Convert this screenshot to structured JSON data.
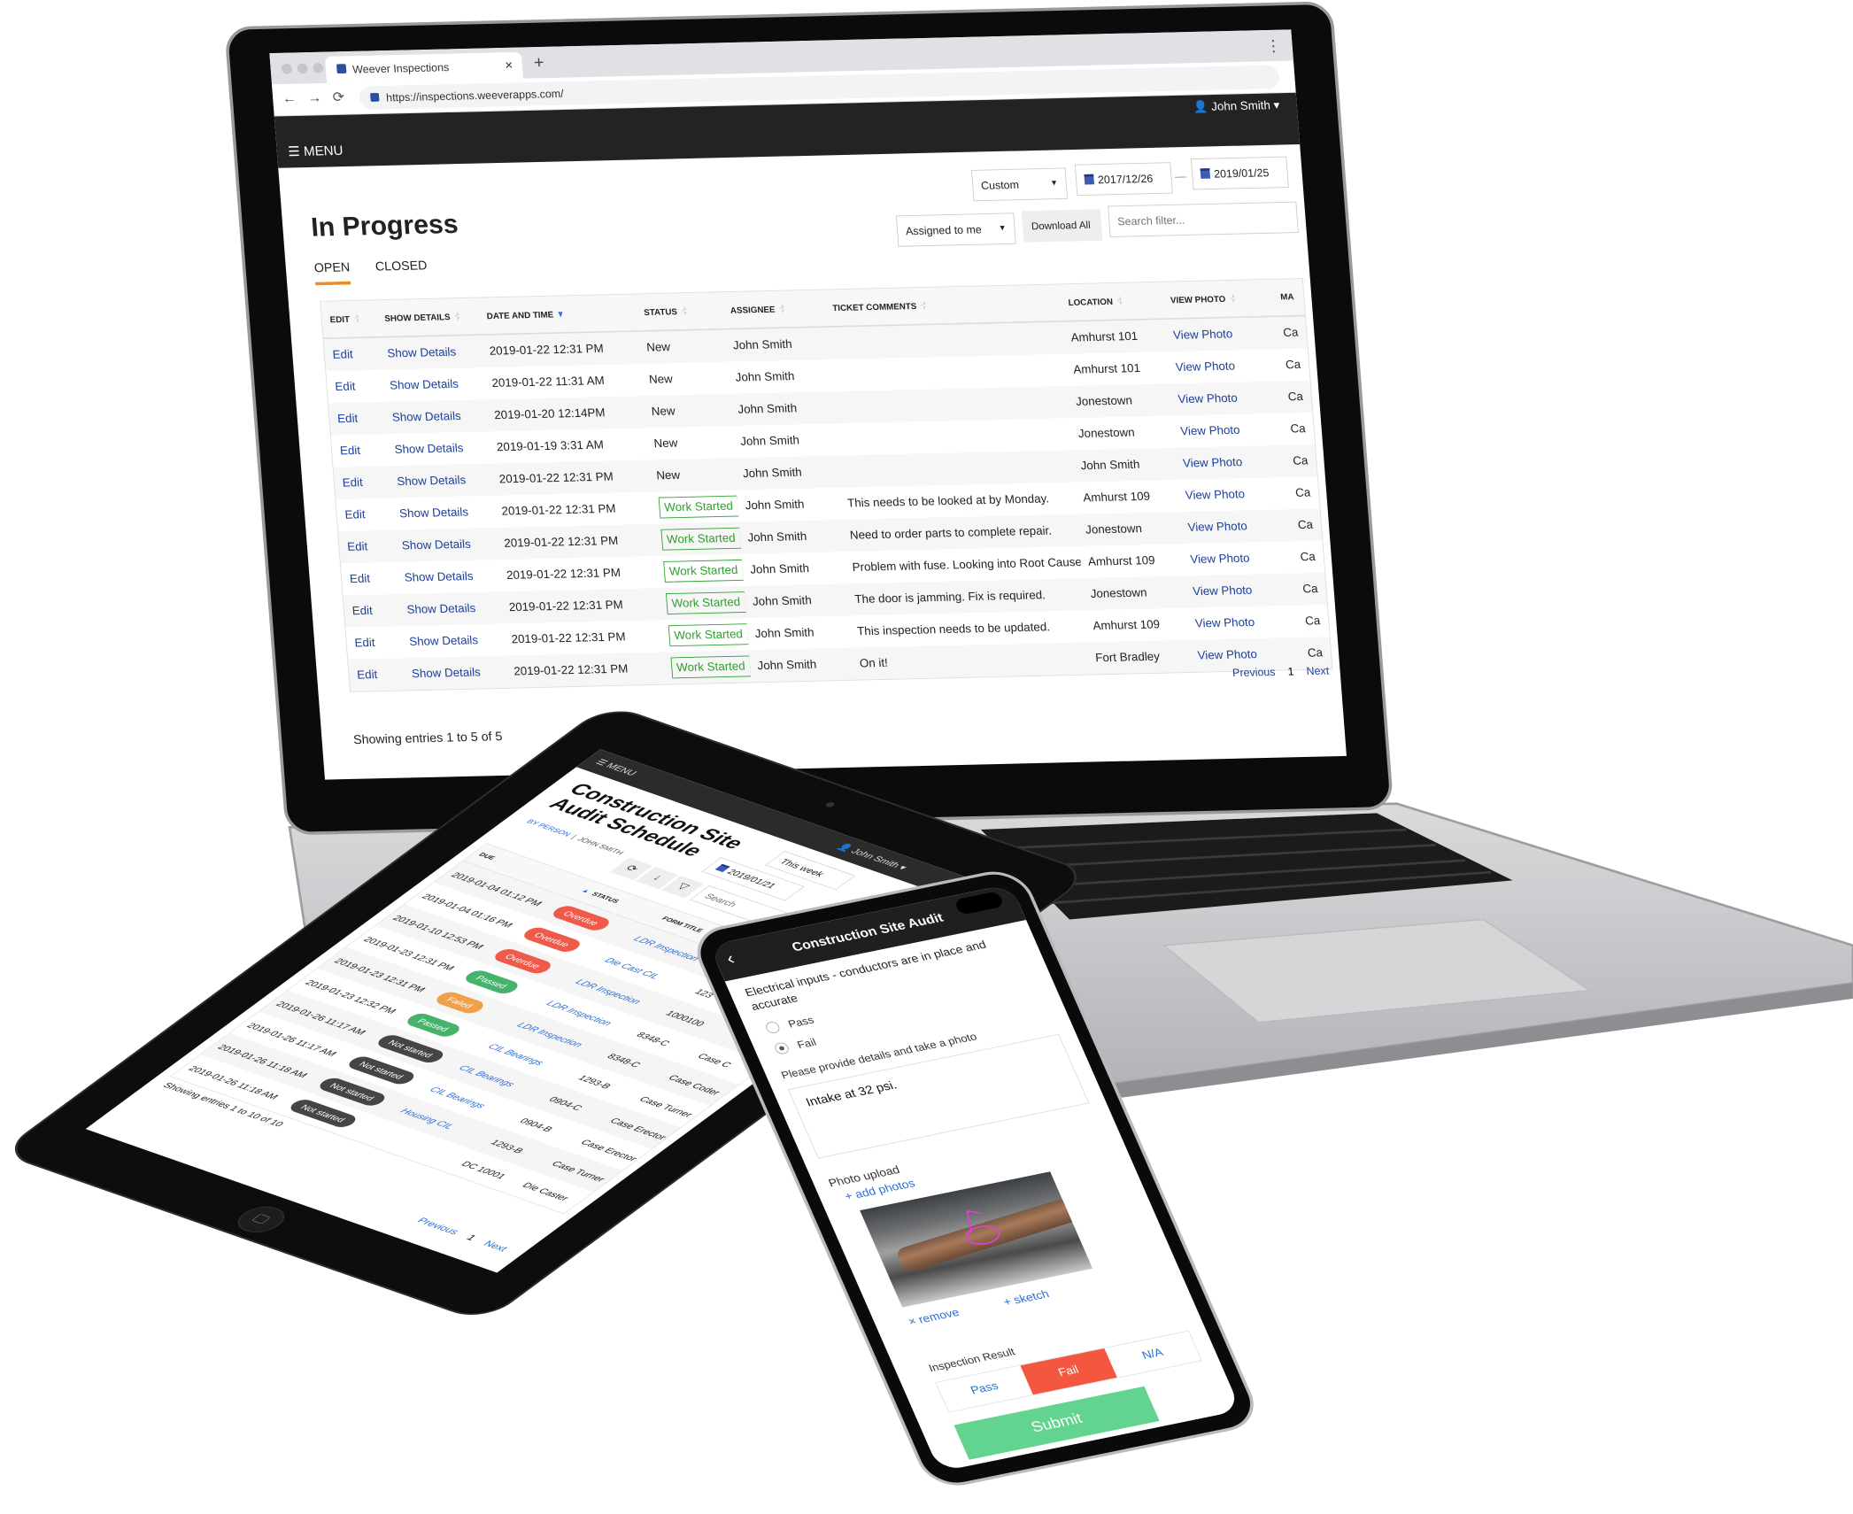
{
  "laptop": {
    "browser": {
      "tab_title": "Weever Inspections",
      "tab_close": "×",
      "new_tab": "+",
      "url": "https://inspections.weeverapps.com/",
      "menu_dots": "⋮",
      "back": "←",
      "forward": "→",
      "reload": "⟳"
    },
    "header": {
      "menu_label": "☰ MENU",
      "user": "👤 John Smith ▾"
    },
    "page_title": "In Progress",
    "filters": {
      "range": "Custom",
      "date_from": "2017/12/26",
      "date_sep": "—",
      "date_to": "2019/01/25",
      "assigned": "Assigned to me",
      "download": "Download All",
      "search_placeholder": "Search filter..."
    },
    "tabs": [
      {
        "label": "OPEN",
        "active": true
      },
      {
        "label": "CLOSED",
        "active": false
      }
    ],
    "table": {
      "columns": [
        "EDIT",
        "SHOW DETAILS",
        "DATE AND TIME",
        "STATUS",
        "ASSIGNEE",
        "TICKET COMMENTS",
        "LOCATION",
        "VIEW PHOTO",
        "MA"
      ],
      "rows": [
        {
          "edit": "Edit",
          "details": "Show Details",
          "date": "2019-01-22 12:31 PM",
          "status": "New",
          "assignee": "John Smith",
          "comment": "",
          "location": "Amhurst 101",
          "photo": "View Photo",
          "extra": "Ca"
        },
        {
          "edit": "Edit",
          "details": "Show Details",
          "date": "2019-01-22 11:31 AM",
          "status": "New",
          "assignee": "John Smith",
          "comment": "",
          "location": "Amhurst 101",
          "photo": "View Photo",
          "extra": "Ca"
        },
        {
          "edit": "Edit",
          "details": "Show Details",
          "date": "2019-01-20 12:14PM",
          "status": "New",
          "assignee": "John Smith",
          "comment": "",
          "location": "Jonestown",
          "photo": "View Photo",
          "extra": "Ca"
        },
        {
          "edit": "Edit",
          "details": "Show Details",
          "date": "2019-01-19 3:31 AM",
          "status": "New",
          "assignee": "John Smith",
          "comment": "",
          "location": "Jonestown",
          "photo": "View Photo",
          "extra": "Ca"
        },
        {
          "edit": "Edit",
          "details": "Show Details",
          "date": "2019-01-22 12:31 PM",
          "status": "New",
          "assignee": "John Smith",
          "comment": "",
          "location": "John Smith",
          "photo": "View Photo",
          "extra": "Ca"
        },
        {
          "edit": "Edit",
          "details": "Show Details",
          "date": "2019-01-22 12:31 PM",
          "status": "Work Started",
          "assignee": "John Smith",
          "comment": "This needs to be looked at by Monday.",
          "location": "Amhurst 109",
          "photo": "View Photo",
          "extra": "Ca"
        },
        {
          "edit": "Edit",
          "details": "Show Details",
          "date": "2019-01-22 12:31 PM",
          "status": "Work Started",
          "assignee": "John Smith",
          "comment": "Need to order parts to complete repair.",
          "location": "Jonestown",
          "photo": "View Photo",
          "extra": "Ca"
        },
        {
          "edit": "Edit",
          "details": "Show Details",
          "date": "2019-01-22 12:31 PM",
          "status": "Work Started",
          "assignee": "John Smith",
          "comment": "Problem with fuse. Looking into Root Cause.",
          "location": "Amhurst 109",
          "photo": "View Photo",
          "extra": "Ca"
        },
        {
          "edit": "Edit",
          "details": "Show Details",
          "date": "2019-01-22 12:31 PM",
          "status": "Work Started",
          "assignee": "John Smith",
          "comment": "The door is jamming. Fix is required.",
          "location": "Jonestown",
          "photo": "View Photo",
          "extra": "Ca"
        },
        {
          "edit": "Edit",
          "details": "Show Details",
          "date": "2019-01-22 12:31 PM",
          "status": "Work Started",
          "assignee": "John Smith",
          "comment": "This inspection needs to be updated.",
          "location": "Amhurst 109",
          "photo": "View Photo",
          "extra": "Ca"
        },
        {
          "edit": "Edit",
          "details": "Show Details",
          "date": "2019-01-22 12:31 PM",
          "status": "Work Started",
          "assignee": "John Smith",
          "comment": "On it!",
          "location": "Fort Bradley",
          "photo": "View Photo",
          "extra": "Ca"
        }
      ]
    },
    "footer": {
      "showing": "Showing entries 1 to 5 of 5",
      "previous": "Previous",
      "page": "1",
      "next": "Next"
    },
    "colors": {
      "accent": "#f08a24",
      "link": "#1b3f9c",
      "work_started": "#2f9f2f",
      "header_bg": "#232323"
    }
  },
  "tablet": {
    "menu_label": "☰ MENU",
    "user": "👤 John Smith ▾",
    "title": "Construction Site Audit Schedule",
    "breadcrumb": {
      "parent": "BY PERSON",
      "sep": "|",
      "current": "JOHN SMITH"
    },
    "filters": {
      "range": "This week",
      "date": "2019/01/21",
      "search_placeholder": "Search"
    },
    "icons": [
      "refresh-icon",
      "download-icon",
      "filter-icon"
    ],
    "table": {
      "columns": [
        "DUE",
        "STATUS",
        "FORM TITLE",
        "",
        ""
      ],
      "rows": [
        {
          "due": "2019-01-04 01:12 PM",
          "status": "Overdue",
          "form": "LDR Inspection",
          "code": "",
          "case": ""
        },
        {
          "due": "2019-01-04 01:16 PM",
          "status": "Overdue",
          "form": "Die Cast CIL",
          "code": "123",
          "case": ""
        },
        {
          "due": "2019-01-10 12:53 PM",
          "status": "Overdue",
          "form": "LDR Inspection",
          "code": "1000100",
          "case": ""
        },
        {
          "due": "2019-01-23 12:31 PM",
          "status": "Passed",
          "form": "LDR Inspection",
          "code": "8348-C",
          "case": "Case C"
        },
        {
          "due": "2019-01-23 12:31 PM",
          "status": "Failed",
          "form": "LDR Inspection",
          "code": "8348-C",
          "case": "Case Coder"
        },
        {
          "due": "2019-01-23 12:32 PM",
          "status": "Passed",
          "form": "CIL Bearings",
          "code": "1293-B",
          "case": "Case Turner"
        },
        {
          "due": "2019-01-26 11:17 AM",
          "status": "Not started",
          "form": "CIL Bearings",
          "code": "0904-C",
          "case": "Case Erector"
        },
        {
          "due": "2019-01-26 11:17 AM",
          "status": "Not started",
          "form": "CIL Bearings",
          "code": "0904-B",
          "case": "Case Erector"
        },
        {
          "due": "2019-01-26 11:18 AM",
          "status": "Not started",
          "form": "Housing CIL",
          "code": "1293-B",
          "case": "Case Turner"
        },
        {
          "due": "2019-01-26 11:18 AM",
          "status": "Not started",
          "form": "",
          "code": "DC 10001",
          "case": "Die Caster"
        }
      ]
    },
    "footer": {
      "showing": "Showing entries 1 to 10 of 10",
      "previous": "Previous",
      "page": "1",
      "next": "Next"
    },
    "status_colors": {
      "Overdue": "#f05a4a",
      "Passed": "#45b36b",
      "Failed": "#f0a04b",
      "Not started": "#454545"
    }
  },
  "phone": {
    "back": "‹",
    "title": "Construction Site Audit",
    "question": "Electrical inputs - conductors are in place and accurate",
    "options": [
      {
        "label": "Pass",
        "selected": false
      },
      {
        "label": "Fail",
        "selected": true
      }
    ],
    "details_label": "Please provide details and take a photo",
    "details_value": "Intake at 32 psi.",
    "photo_label": "Photo upload",
    "add_photos": "+ add photos",
    "remove": "× remove",
    "sketch": "+ sketch",
    "result_label": "Inspection Result",
    "result_options": [
      {
        "label": "Pass",
        "selected": false
      },
      {
        "label": "Fail",
        "selected": true
      },
      {
        "label": "N/A",
        "selected": false
      }
    ],
    "submit": "Submit",
    "colors": {
      "fail": "#f4573f",
      "submit": "#62d48f",
      "link": "#2a6fd6"
    }
  }
}
